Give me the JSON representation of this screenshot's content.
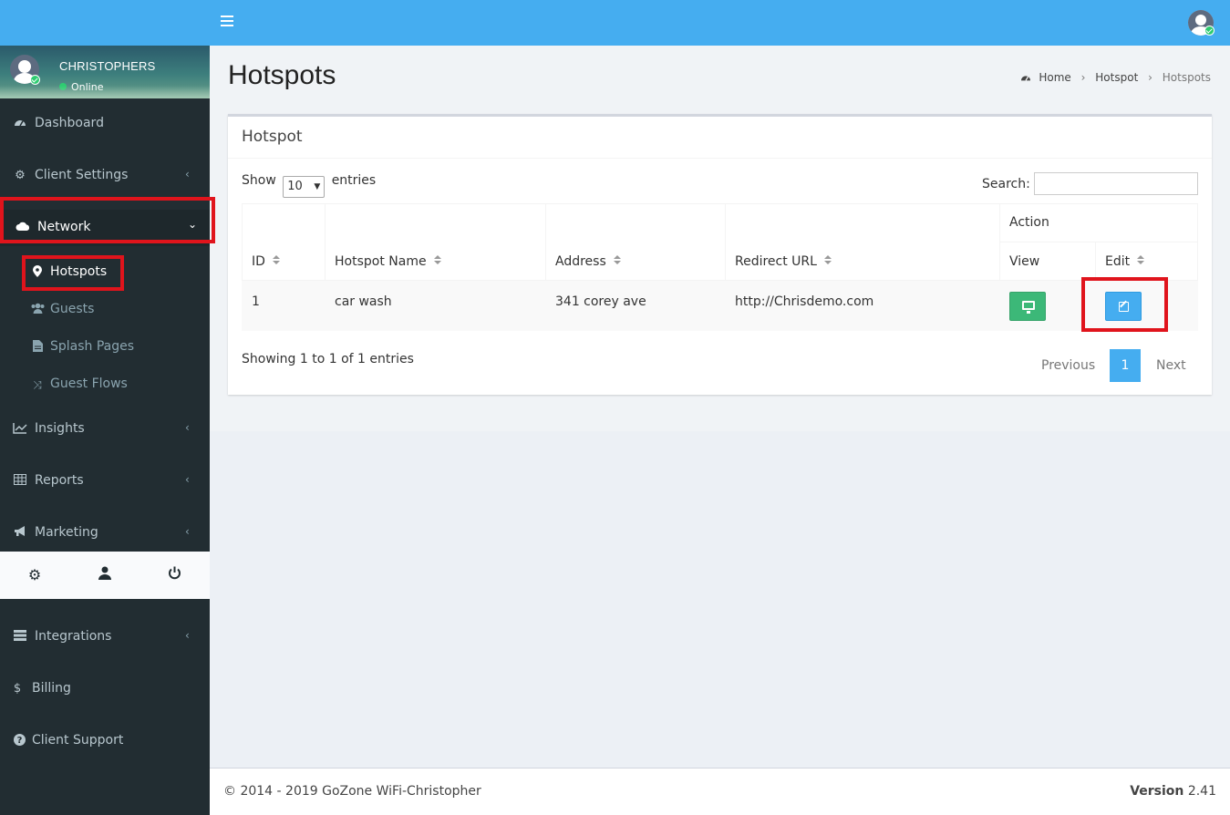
{
  "user": {
    "name": "CHRISTOPHERS",
    "status": "Online"
  },
  "sidebar": {
    "items": [
      {
        "label": "Dashboard",
        "icon": "dashboard-icon"
      },
      {
        "label": "Client Settings",
        "icon": "gear-icon"
      },
      {
        "label": "Network",
        "icon": "cloud-icon"
      },
      {
        "label": "Insights",
        "icon": "line-chart-icon"
      },
      {
        "label": "Reports",
        "icon": "table-icon"
      },
      {
        "label": "Marketing",
        "icon": "bullhorn-icon"
      },
      {
        "label": "Integrations",
        "icon": "server-icon"
      },
      {
        "label": "Billing",
        "icon": "dollar-icon"
      },
      {
        "label": "Client Support",
        "icon": "question-icon"
      }
    ],
    "network_sub": [
      {
        "label": "Hotspots",
        "icon": "map-marker-icon"
      },
      {
        "label": "Guests",
        "icon": "users-icon"
      },
      {
        "label": "Splash Pages",
        "icon": "file-icon"
      },
      {
        "label": "Guest Flows",
        "icon": "random-icon"
      }
    ],
    "footer_icons": [
      "gear-icon",
      "user-icon",
      "power-icon"
    ]
  },
  "page": {
    "title": "Hotspots",
    "breadcrumb": {
      "home": "Home",
      "parent": "Hotspot",
      "current": "Hotspots"
    }
  },
  "box": {
    "title": "Hotspot",
    "show_label": "Show",
    "entries_label": "entries",
    "page_size": "10",
    "search_label": "Search:",
    "search_value": "",
    "columns": {
      "id": "ID",
      "name": "Hotspot Name",
      "address": "Address",
      "redirect": "Redirect URL",
      "action": "Action",
      "view": "View",
      "edit": "Edit"
    },
    "rows": [
      {
        "id": "1",
        "name": "car wash",
        "address": "341 corey ave",
        "redirect": "http://Chrisdemo.com"
      }
    ],
    "showing": "Showing 1 to 1 of 1 entries",
    "pagination": {
      "prev": "Previous",
      "current": "1",
      "next": "Next"
    }
  },
  "colors": {
    "accent": "#45adf0",
    "sidebar": "#222d32",
    "view_button": "#3cb878",
    "highlight": "#e0141c"
  },
  "footer": {
    "copyright": "© 2014 - 2019 GoZone WiFi-Christopher",
    "version_label": "Version",
    "version": "2.41"
  }
}
